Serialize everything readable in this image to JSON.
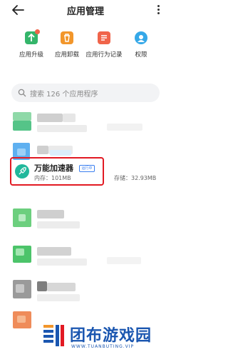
{
  "header": {
    "title": "应用管理"
  },
  "actions": [
    {
      "label": "应用升级",
      "icon": "app-upgrade-icon",
      "color": "#34b56a"
    },
    {
      "label": "应用卸载",
      "icon": "trash-icon",
      "color": "#f2962b"
    },
    {
      "label": "应用行为记录",
      "icon": "record-icon",
      "color": "#f0644a"
    },
    {
      "label": "权限",
      "icon": "permission-icon",
      "color": "#35a8e8"
    }
  ],
  "search": {
    "placeholder": "搜索 126 个应用程序"
  },
  "highlight_app": {
    "name": "万能加速器",
    "badge": "运行中",
    "memory": "内存：101MB",
    "storage": "存储：32.93MB",
    "icon": "rocket-icon",
    "accent": "#e21a23"
  },
  "watermark": {
    "brand": "团布游戏园",
    "url": "WWW.TUANBUTING.VIP",
    "color": "#1a56b0"
  }
}
